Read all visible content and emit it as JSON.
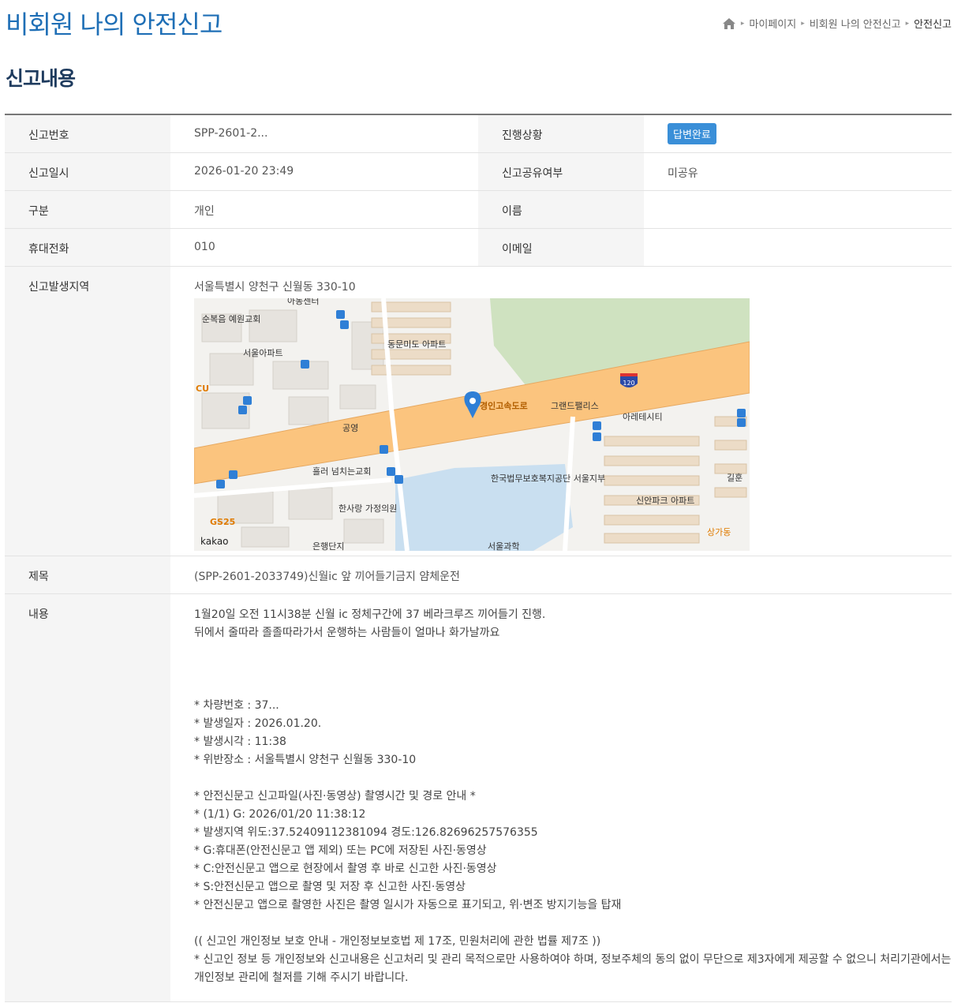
{
  "header": {
    "title": "비회원 나의 안전신고",
    "breadcrumb": [
      "마이페이지",
      "비회원 나의 안전신고",
      "안전신고"
    ]
  },
  "section_title": "신고내용",
  "detail": {
    "report_no_label": "신고번호",
    "report_no": "SPP-2601-2...",
    "status_label": "진행상황",
    "status": "답변완료",
    "date_label": "신고일시",
    "date": "2026-01-20 23:49",
    "share_label": "신고공유여부",
    "share": "미공유",
    "type_label": "구분",
    "type": "개인",
    "name_label": "이름",
    "name": "",
    "phone_label": "휴대전화",
    "phone": "010",
    "email_label": "이메일",
    "email": "",
    "area_label": "신고발생지역",
    "area": "서울특별시 양천구 신월동 330-10",
    "subject_label": "제목",
    "subject": "(SPP-2601-2033749)신월ic 앞 끼어들기금지 얌체운전",
    "body_label": "내용",
    "body": [
      "1월20일 오전 11시38분 신월 ic 정체구간에 37           베라크루즈 끼어들기 진행.",
      "뒤에서 줄따라 졸졸따라가서 운행하는 사람들이 얼마나 화가날까요",
      "",
      "",
      "",
      "* 차량번호 : 37...",
      "* 발생일자 : 2026.01.20.",
      "* 발생시각 : 11:38",
      "* 위반장소 : 서울특별시 양천구 신월동 330-10",
      "",
      "* 안전신문고 신고파일(사진·동영상) 촬영시간 및 경로 안내 *",
      "* (1/1) G: 2026/01/20 11:38:12",
      "* 발생지역 위도:37.52409112381094 경도:126.82696257576355",
      "* G:휴대폰(안전신문고 앱 제외) 또는 PC에 저장된 사진·동영상",
      "* C:안전신문고 앱으로 현장에서 촬영 후 바로 신고한 사진·동영상",
      "* S:안전신문고 앱으로 촬영 및 저장 후 신고한 사진·동영상",
      "* 안전신문고 앱으로 촬영한 사진은 촬영 일시가 자동으로 표기되고, 위·변조 방지기능을 탑재",
      "",
      "(( 신고인 개인정보 보호 안내 - 개인정보보호법 제 17조, 민원처리에 관한 법률 제7조 ))",
      "* 신고인 정보 등 개인정보와 신고내용은 신고처리 및 관리 목적으로만 사용하여야 하며, 정보주체의 동의 없이 무단으로 제3자에게 제공할 수 없으니 처리기관에서는",
      "개인정보 관리에 철저를 기해 주시기 바랍니다."
    ]
  },
  "map": {
    "road": "경인고속도로",
    "route_no": "120",
    "brand": "kakao",
    "labels": [
      "순복음 예원교회",
      "서울아파트",
      "동문미도 아파트",
      "CU",
      "공영",
      "그랜드팰리스",
      "아레테시티",
      "흘러 넘치는교회",
      "한국법무보호복지공단 서울지부",
      "신안파크 아파트",
      "한사랑 가정의원",
      "GS25",
      "상가동",
      "길훈",
      "은행단지",
      "서울과학",
      "아동센터"
    ],
    "colors": {
      "road": "#fbc47e",
      "green": "#cfe2c0",
      "water": "#c9dff0",
      "pin": "#2f7fd6"
    }
  }
}
